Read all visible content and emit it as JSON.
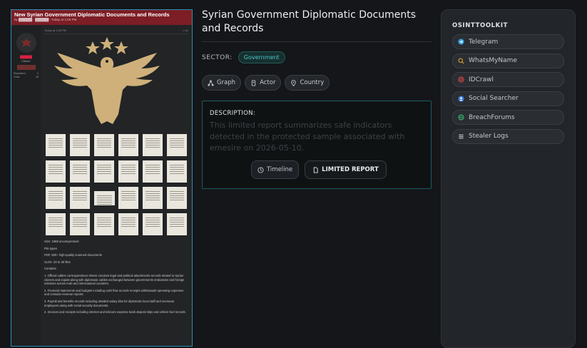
{
  "preview": {
    "title": "New Syrian Government Diplomatic Documents and Records",
    "subtitle": "by ██████ - ██████ - Today at 1:00 PM",
    "post_date": "Today at 1:00 PM",
    "username": "██████",
    "rank": "Citizen",
    "stats": [
      {
        "label": "Reputation",
        "value": "0"
      },
      {
        "label": "Posts",
        "value": "28"
      }
    ],
    "body_lines": [
      "Size: 1968 uncompressed",
      "File types",
      "PDF, 500+ high-quality scanned documents",
      "XLSX: 20 to 30 files",
      "Contains:",
      "1. Official cables correspondence letters circulars legal and political attachments records related to Syrian citizens and expats along with diplomatic cables exchanged between governments embassies and foreign missions across Arab and international countries.",
      "2. Financial statements and budgets including cash flow records receipts withdrawals operating expenses and consular revenue reports.",
      "3. Payroll and benefits records including detailed salary lists for diplomatic local staff and overseas employees along with social security documents.",
      "4. Invoices and receipts including internet and telecom expense bank deposit slips and vehicle fuel records."
    ]
  },
  "main": {
    "title": "Syrian Government Diplomatic Documents and Records",
    "sector_label": "SECTOR:",
    "sector_value": "Government",
    "actions": [
      {
        "label": "Graph",
        "icon": "graph-icon"
      },
      {
        "label": "Actor",
        "icon": "actor-icon"
      },
      {
        "label": "Country",
        "icon": "location-pin-icon"
      }
    ],
    "description_label": "DESCRIPTION:",
    "description_text": "This limited report summarizes safe indicators detected in the protected sample associated with emesire on 2026-05-10.",
    "timeline_label": "Timeline",
    "report_label": "LIMITED REPORT"
  },
  "toolkit": {
    "title": "OSINTTOOLKIT",
    "items": [
      {
        "label": "Telegram",
        "icon": "telegram-icon",
        "color": "#3aa0e0"
      },
      {
        "label": "WhatsMyName",
        "icon": "search-icon",
        "color": "#e0a030"
      },
      {
        "label": "IDCrawl",
        "icon": "fingerprint-icon",
        "color": "#e04848"
      },
      {
        "label": "Social Searcher",
        "icon": "social-icon",
        "color": "#3a7ad8"
      },
      {
        "label": "BreachForums",
        "icon": "globe-icon",
        "color": "#39b870"
      },
      {
        "label": "Stealer Logs",
        "icon": "logs-icon",
        "color": "#c8ccd2"
      }
    ]
  },
  "colors": {
    "accent": "#2d8fb0",
    "preview_header": "#7d1d25",
    "sector": "#4fc3c8",
    "emblem": "#cfb07a"
  }
}
